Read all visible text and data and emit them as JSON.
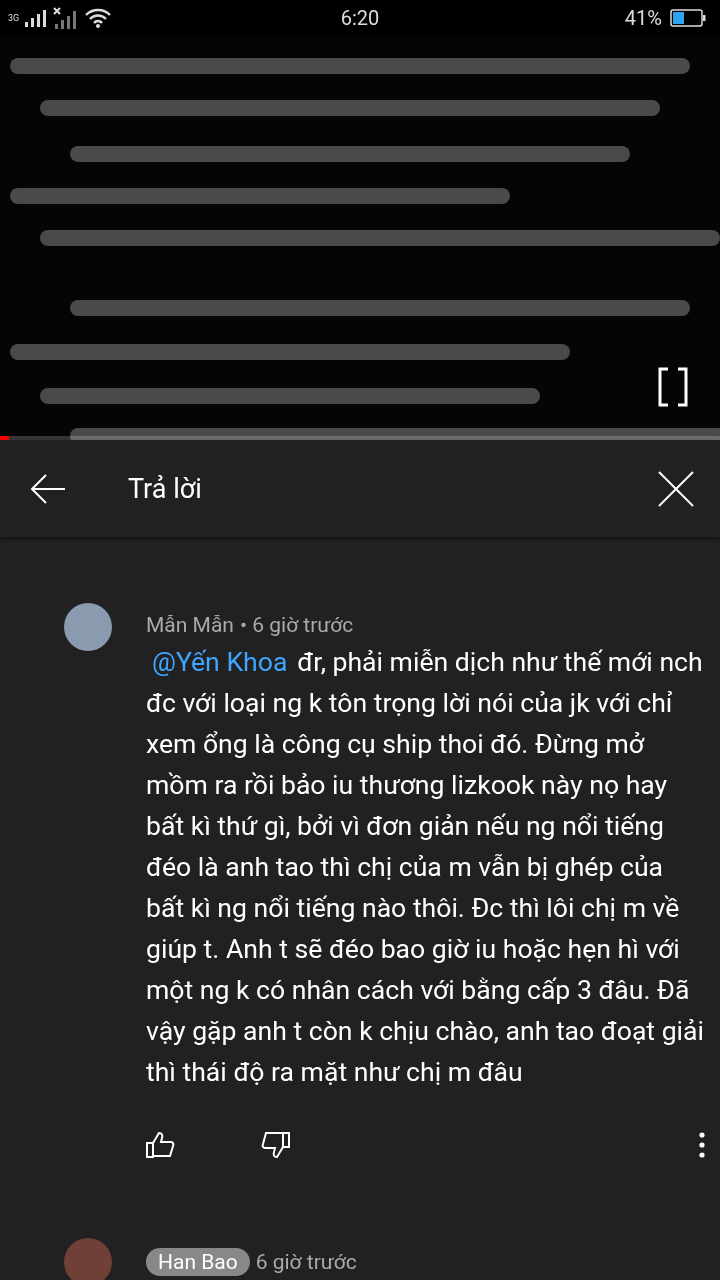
{
  "status_bar": {
    "network": "3G",
    "time": "6:20",
    "battery_text": "41%"
  },
  "video": {
    "kind": "picture",
    "progress": {
      "level": 0.012
    }
  },
  "header": {
    "title": "Trả lời"
  },
  "comments": [
    {
      "author": "Mẫn Mẫn",
      "author_badge": false,
      "time": "• 6 giờ trước",
      "mention": "@Yến Khoa",
      "text": "đr, phải miễn dịch như thế mới nch đc với loại ng k tôn trọng lời nói của jk với chỉ xem ổng là công cụ ship thoi đó. Đừng mở mồm ra rồi bảo iu thương lizkook này nọ hay bất kì thứ gì, bởi vì đơn giản nếu ng nổi tiếng đéo là anh tao thì chị của m vẫn bị ghép của bất kì ng nổi tiếng nào thôi. Đc thì lôi chị m về giúp t. Anh t sẽ đéo bao giờ iu hoặc hẹn hì với một ng k có nhân cách với bằng cấp 3 đâu. Đã vậy gặp anh t còn k chịu chào, anh tao đoạt giải thì thái độ ra mặt như chị m đâu"
    },
    {
      "author": "Han Bao",
      "author_badge": true,
      "time": "6 giờ trước"
    }
  ]
}
